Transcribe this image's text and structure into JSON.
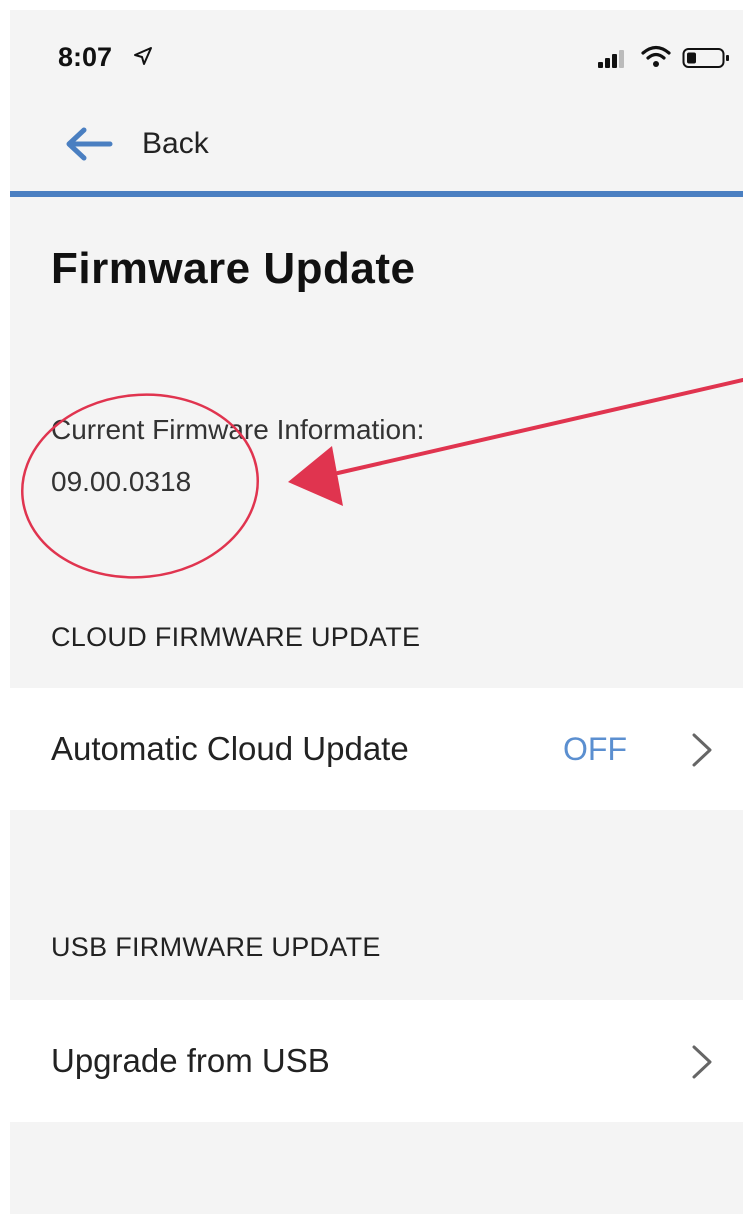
{
  "status_bar": {
    "time": "8:07",
    "icons": [
      "location-arrow-icon",
      "cellular-signal-icon",
      "wifi-icon",
      "battery-icon"
    ]
  },
  "nav": {
    "back_label": "Back",
    "accent_color": "#4a7fc1"
  },
  "page": {
    "title": "Firmware Update"
  },
  "firmware": {
    "label": "Current Firmware Information:",
    "version": "09.00.0318"
  },
  "sections": {
    "cloud": {
      "header": "CLOUD FIRMWARE UPDATE",
      "row_label": "Automatic Cloud Update",
      "row_value": "OFF",
      "value_color": "#5b8fd0"
    },
    "usb": {
      "header": "USB FIRMWARE UPDATE",
      "row_label": "Upgrade from USB"
    }
  },
  "annotation": {
    "color": "#e0344f",
    "shapes": [
      "circle",
      "arrow"
    ]
  }
}
